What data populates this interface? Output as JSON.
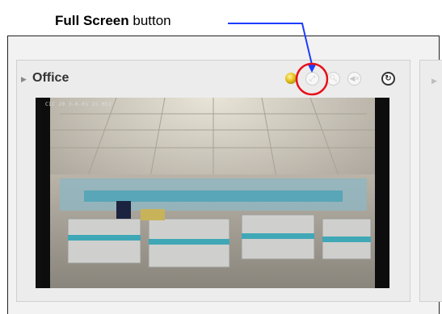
{
  "callout": {
    "bold": "Full Screen",
    "rest": " button"
  },
  "camera": {
    "name": "Office",
    "timestamp": "CIC 20 3-0-01 IS M52"
  },
  "colors": {
    "callout_arrow": "#1e3cff",
    "highlight_circle": "#e8111a",
    "status_led": "#e4c21a"
  },
  "icons": [
    "expand-arrow-icon",
    "status-led-icon",
    "full-screen-icon",
    "zoom-icon",
    "mute-icon",
    "refresh-icon"
  ]
}
